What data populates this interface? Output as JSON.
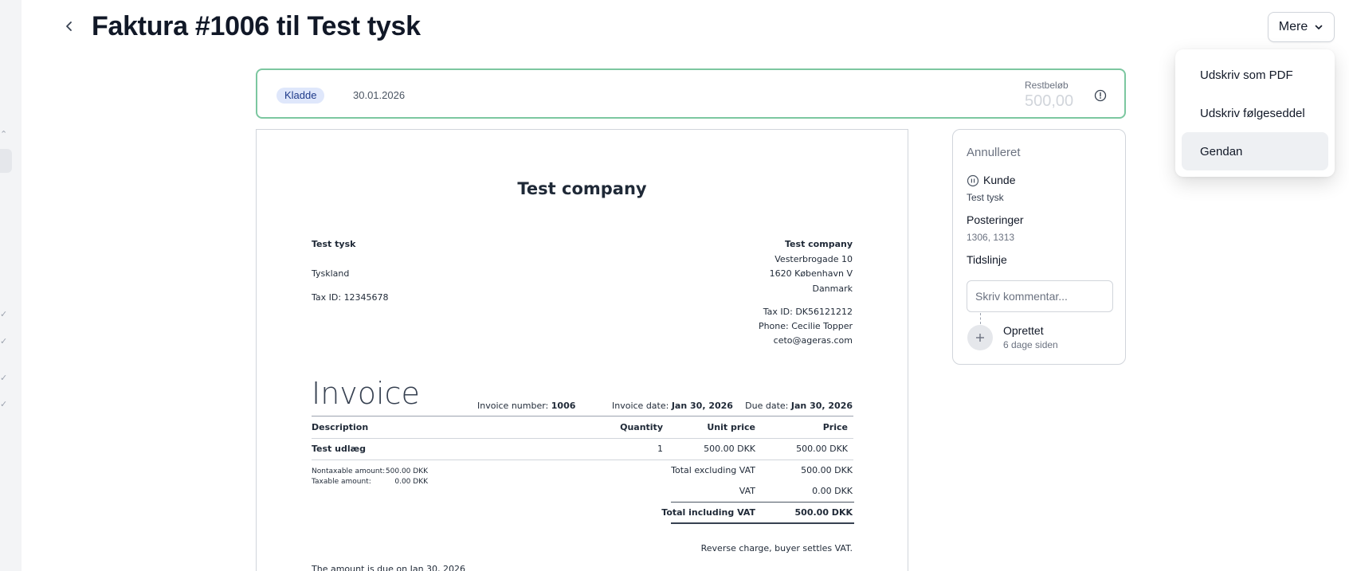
{
  "page": {
    "title": "Faktura #1006 til Test tysk",
    "more_label": "Mere"
  },
  "dropdown": {
    "items": [
      {
        "label": "Udskriv som PDF"
      },
      {
        "label": "Udskriv følgeseddel"
      },
      {
        "label": "Gendan"
      }
    ]
  },
  "status": {
    "badge": "Kladde",
    "date": "30.01.2026",
    "rest_label": "Restbeløb",
    "rest_value": "500,00"
  },
  "invoice": {
    "company_title": "Test company",
    "customer": {
      "name": "Test tysk",
      "country": "Tyskland",
      "tax_id": "Tax ID: 12345678"
    },
    "sender": {
      "name": "Test company",
      "street": "Vesterbrogade 10",
      "city": "1620 København V",
      "country": "Danmark",
      "tax_id": "Tax ID: DK56121212",
      "phone": "Phone: Cecilie Topper",
      "email": "ceto@ageras.com"
    },
    "heading": "Invoice",
    "number_label": "Invoice number:",
    "number": "1006",
    "date_label": "Invoice date:",
    "date": "Jan 30, 2026",
    "due_label": "Due date:",
    "due": "Jan 30, 2026",
    "columns": {
      "description": "Description",
      "quantity": "Quantity",
      "unit_price": "Unit price",
      "price": "Price"
    },
    "lines": [
      {
        "description": "Test udlæg",
        "quantity": "1",
        "unit_price": "500.00 DKK",
        "price": "500.00 DKK"
      }
    ],
    "nontaxable_label": "Nontaxable amount:",
    "nontaxable_value": "500.00 DKK",
    "taxable_label": "Taxable amount:",
    "taxable_value": "0.00 DKK",
    "total_excl_label": "Total excluding VAT",
    "total_excl_value": "500.00 DKK",
    "vat_label": "VAT",
    "vat_value": "0.00 DKK",
    "total_incl_label": "Total including VAT",
    "total_incl_value": "500.00 DKK",
    "reverse_charge": "Reverse charge, buyer settles VAT.",
    "due_note": "The amount is due on Jan 30, 2026"
  },
  "side": {
    "status": "Annulleret",
    "customer_label": "Kunde",
    "customer_value": "Test tysk",
    "postings_label": "Posteringer",
    "postings_value": "1306, 1313",
    "timeline_label": "Tidslinje",
    "comment_placeholder": "Skriv kommentar...",
    "event_title": "Oprettet",
    "event_time": "6 dage siden"
  },
  "icons": {
    "back": "chevron-left-icon",
    "more": "chevron-down-icon",
    "info": "info-circle-icon",
    "customer": "pause-circle-icon",
    "timeline": "plus-icon"
  },
  "colors": {
    "status_border": "#7cc7a0",
    "badge_bg": "#dfe7fb",
    "badge_text": "#1e3a8a",
    "hover_bg": "#eef0f3"
  }
}
